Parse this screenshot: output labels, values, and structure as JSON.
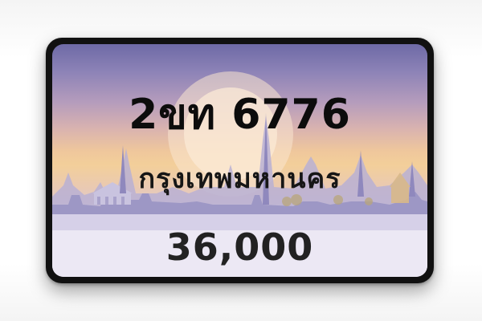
{
  "plate": {
    "registration": "2ขท 6776",
    "province": "กรุงเทพมหานคร",
    "price": "36,000"
  },
  "colors": {
    "plate_frame": "#111111",
    "sky_top": "#6e6aa6",
    "sky_mid": "#f3cf9a",
    "sky_bottom": "#f1eef6",
    "sun": "#f7dfc8",
    "skyline": "#9b95c4",
    "text": "#0c0c0c"
  }
}
